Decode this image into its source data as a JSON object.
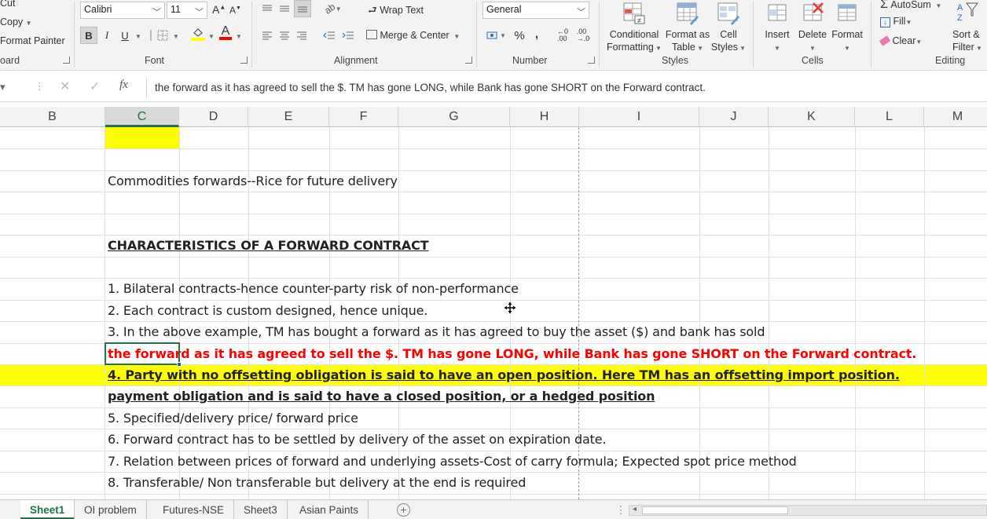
{
  "clipboard": {
    "cut_label": "Cut",
    "copy_label": "Copy",
    "format_painter_label": "Format Painter",
    "group_label": "oard"
  },
  "font": {
    "name_value": "Calibri",
    "size_value": "11",
    "bold_label": "B",
    "italic_label": "I",
    "underline_label": "U",
    "font_color": "#ff0000",
    "fill_color": "#ffff00",
    "group_label": "Font"
  },
  "alignment": {
    "wrap_text_label": "Wrap Text",
    "merge_center_label": "Merge & Center",
    "group_label": "Alignment"
  },
  "number": {
    "format_value": "General",
    "percent_label": "%",
    "comma_label": ",",
    "group_label": "Number"
  },
  "styles": {
    "conditional_formatting_line1": "Conditional",
    "conditional_formatting_line2": "Formatting",
    "format_as_table_line1": "Format as",
    "format_as_table_line2": "Table",
    "cell_styles_line1": "Cell",
    "cell_styles_line2": "Styles",
    "group_label": "Styles"
  },
  "cells": {
    "insert_label": "Insert",
    "delete_label": "Delete",
    "format_label": "Format",
    "group_label": "Cells"
  },
  "editing": {
    "autosum_label": "AutoSum",
    "fill_label": "Fill",
    "clear_label": "Clear",
    "sort_filter_line1": "Sort &",
    "sort_filter_line2": "Filter",
    "group_label": "Editing"
  },
  "formula_bar": {
    "fx_label": "fx",
    "content": "the forward as it has agreed to sell the $. TM has gone LONG, while Bank has gone SHORT on the Forward contract."
  },
  "columns": [
    "B",
    "C",
    "D",
    "E",
    "F",
    "G",
    "H",
    "I",
    "J",
    "K",
    "L",
    "M"
  ],
  "active_column": "C",
  "rows": {
    "title": "Commodities forwards--Rice for future delivery",
    "heading": "CHARACTERISTICS OF A FORWARD CONTRACT",
    "item1": "1. Bilateral contracts-hence counter-party risk of non-performance",
    "item2": "2. Each contract is custom designed, hence unique.",
    "item3": "3. In the above example, TM has bought a forward as it has agreed to buy the asset ($) and bank has sold",
    "item3_cont": "the forward as it has agreed to sell the $. TM has gone LONG, while Bank has gone SHORT on the Forward contract.",
    "item4": "4. Party with no offsetting obligation is said to have an open position. Here TM has an offsetting import position.",
    "item4_cont": "payment obligation and is said to have a closed position, or a hedged position",
    "item5": "5. Specified/delivery price/ forward price",
    "item6": "6. Forward contract has to be settled by delivery of the asset on expiration date.",
    "item7": "7. Relation between prices of forward and underlying assets-Cost of carry formula; Expected spot price method",
    "item8": "8. Transferable/ Non transferable but delivery at the end is required"
  },
  "highlight_color": "#ffff00",
  "sheets": [
    "Sheet1",
    "OI problem",
    "Futures-NSE",
    "Sheet3",
    "Asian Paints"
  ],
  "active_sheet": "Sheet1"
}
